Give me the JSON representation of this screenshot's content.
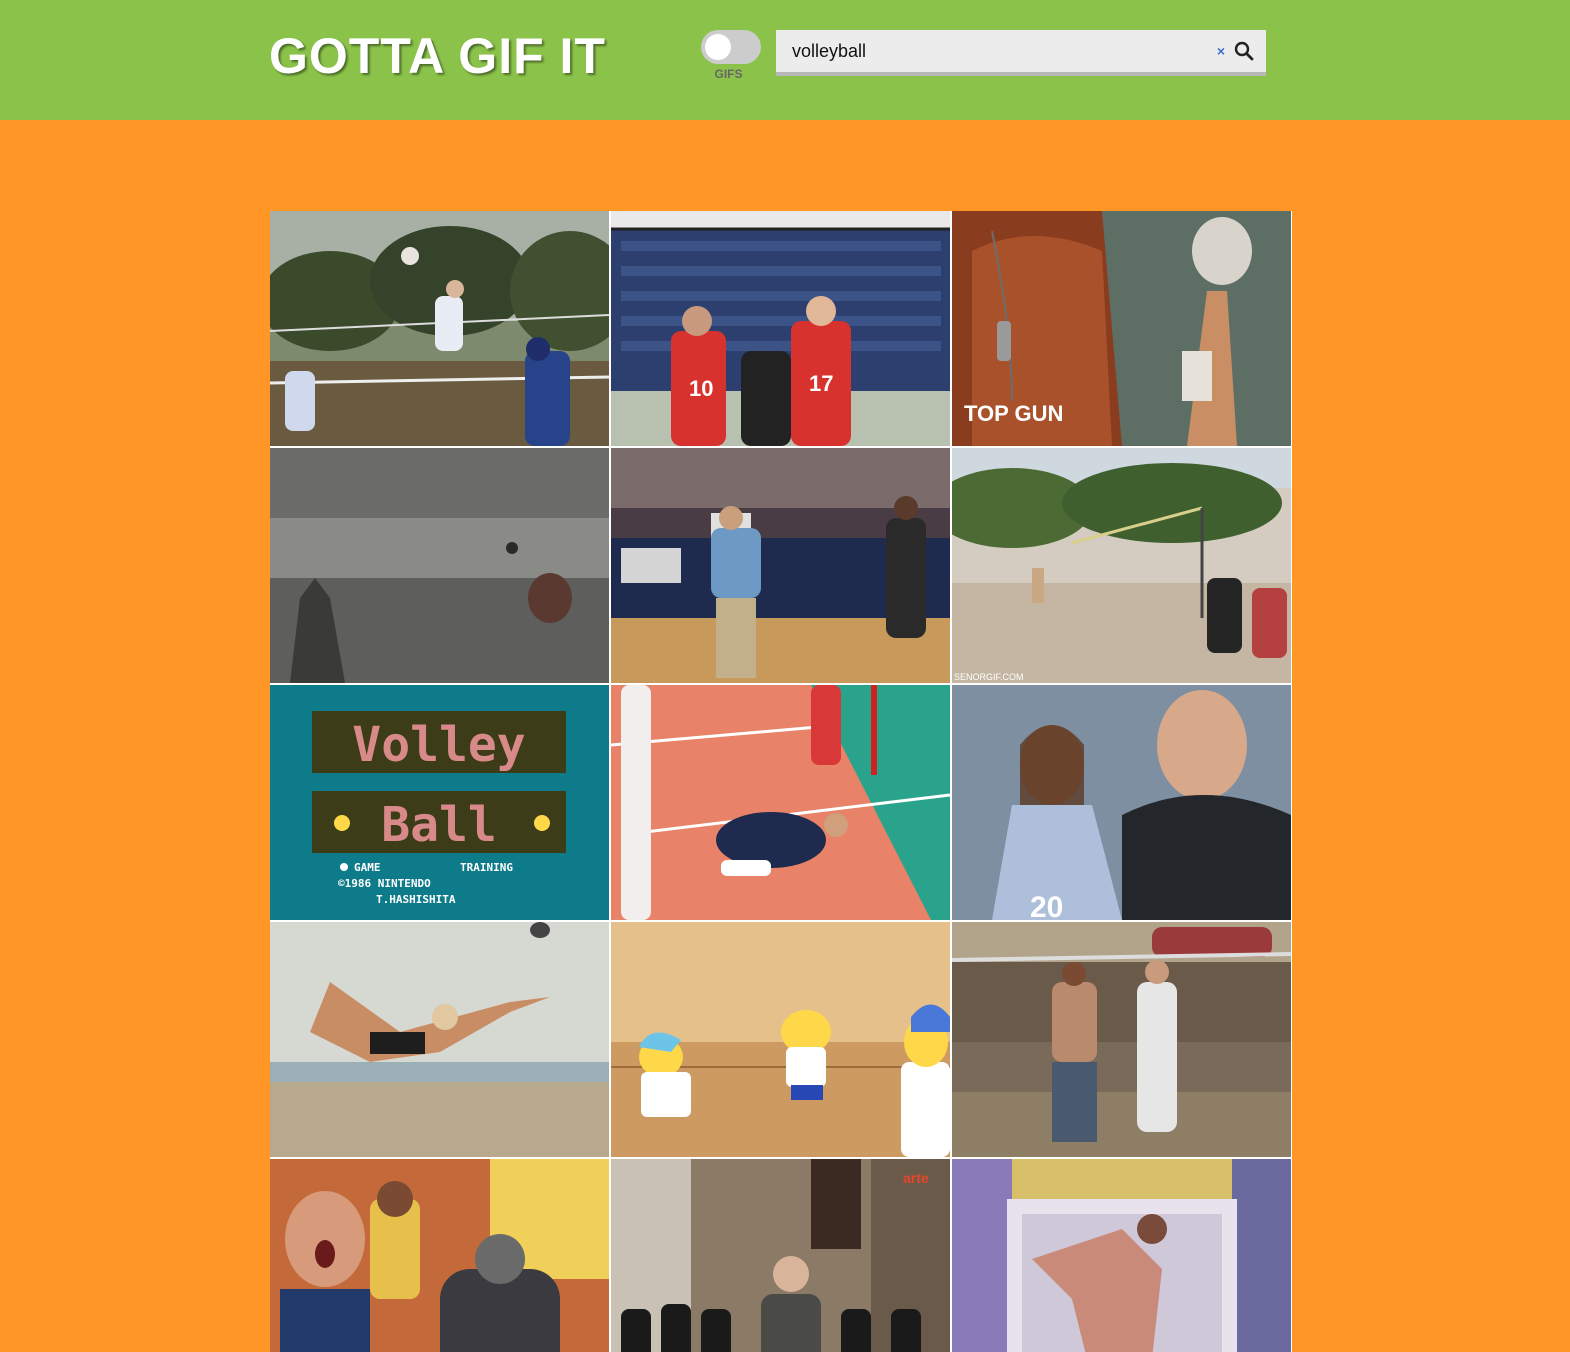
{
  "header": {
    "title": "GOTTA GIF IT",
    "toggle_label": "GIFS",
    "toggle_on": false
  },
  "search": {
    "value": "volleyball",
    "clear_label": "×",
    "search_icon": "search-icon",
    "clear_icon": "close-icon"
  },
  "colors": {
    "header_bg": "#8bc34a",
    "page_bg": "#ff9625",
    "title_text": "#ffffff",
    "clear_icon": "#3a6fd0"
  },
  "results": {
    "count_visible": 15,
    "items": [
      {
        "name": "gif-result-1",
        "scene": "outdoor volleyball spike in park"
      },
      {
        "name": "gif-result-2",
        "scene": "indoor volleyball players in red jerseys"
      },
      {
        "name": "gif-result-3",
        "scene": "volleyball spinning on finger"
      },
      {
        "name": "gif-result-4",
        "scene": "black and white monster scene"
      },
      {
        "name": "gif-result-5",
        "scene": "coach on gym sideline"
      },
      {
        "name": "gif-result-6",
        "scene": "beach volleyball on sand court"
      },
      {
        "name": "gif-result-7",
        "scene": "Volley Ball retro game title screen"
      },
      {
        "name": "gif-result-8",
        "scene": "player diving on orange court"
      },
      {
        "name": "gif-result-9",
        "scene": "player and bald coach"
      },
      {
        "name": "gif-result-10",
        "scene": "woman diving on beach"
      },
      {
        "name": "gif-result-11",
        "scene": "cartoon volleyball in gym"
      },
      {
        "name": "gif-result-12",
        "scene": "shirtless players at net"
      },
      {
        "name": "gif-result-13",
        "scene": "surprised coach with players"
      },
      {
        "name": "gif-result-14",
        "scene": "clergy crowd watching"
      },
      {
        "name": "gif-result-15",
        "scene": "woman serving in bright room"
      }
    ],
    "game_screen": {
      "line1": "Volley",
      "line2": "Ball",
      "menu_left": "GAME",
      "menu_right": "TRAINING",
      "copyright": "©1986 NINTENDO",
      "author": "T.HASHISHITA"
    },
    "movie_logo": "TOP GUN",
    "watermark": "SENORGIF.COM",
    "channel_logo": "arte",
    "jersey_numbers": [
      "10",
      "17",
      "20"
    ]
  }
}
